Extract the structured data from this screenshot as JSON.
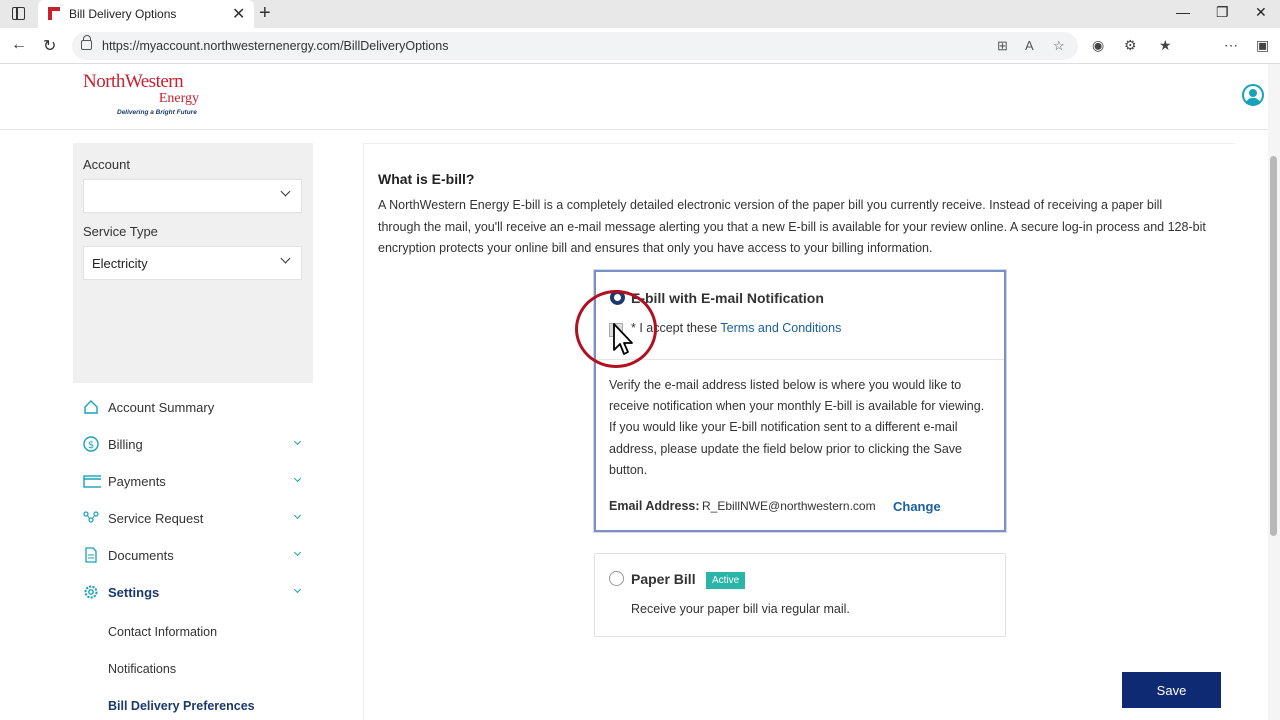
{
  "browser": {
    "tab_title": "Bill Delivery Options",
    "url": "https://myaccount.northwesternenergy.com/BillDeliveryOptions"
  },
  "header": {
    "logo_line1": "NorthWestern",
    "logo_line2": "Energy",
    "logo_tagline": "Delivering a Bright Future"
  },
  "sidebar": {
    "account_label": "Account",
    "account_value": "",
    "service_type_label": "Service Type",
    "service_type_value": "Electricity",
    "nav": [
      {
        "label": "Account Summary",
        "icon": "home-icon"
      },
      {
        "label": "Billing",
        "icon": "dollar-icon"
      },
      {
        "label": "Payments",
        "icon": "card-icon"
      },
      {
        "label": "Service Request",
        "icon": "network-icon"
      },
      {
        "label": "Documents",
        "icon": "document-icon"
      },
      {
        "label": "Settings",
        "icon": "gear-icon"
      }
    ],
    "settings_sub": [
      "Contact Information",
      "Notifications",
      "Bill Delivery Preferences"
    ]
  },
  "main": {
    "title": "What is E-bill?",
    "description": "A NorthWestern Energy E-bill is a completely detailed electronic version of the paper bill you currently receive. Instead of receiving a paper bill through the mail, you'll receive an e-mail message alerting you that a new E-bill is available for your review online. A secure log-in process and 128-bit encryption protects your online bill and ensures that only you have access to your billing information.",
    "ebill": {
      "title": "E-bill with E-mail Notification",
      "terms_prefix": "* I accept these ",
      "terms_link": "Terms and Conditions",
      "verify": "Verify the e-mail address listed below is where you would like to receive notification when your monthly E-bill is available for viewing. If you would like your E-bill notification sent to a different e-mail address, please update the field below prior to clicking the Save button.",
      "email_label": "Email Address:",
      "email_value": "R_EbillNWE@northwestern.com",
      "change_label": "Change"
    },
    "paper": {
      "title": "Paper Bill",
      "badge": "Active",
      "desc": "Receive your paper bill via regular mail."
    },
    "save_label": "Save"
  },
  "colors": {
    "brand_red": "#c8202f",
    "brand_navy": "#1b3a6b",
    "accent_teal": "#17a2b8",
    "save_button": "#0d2a73",
    "badge": "#2bb5a8"
  }
}
